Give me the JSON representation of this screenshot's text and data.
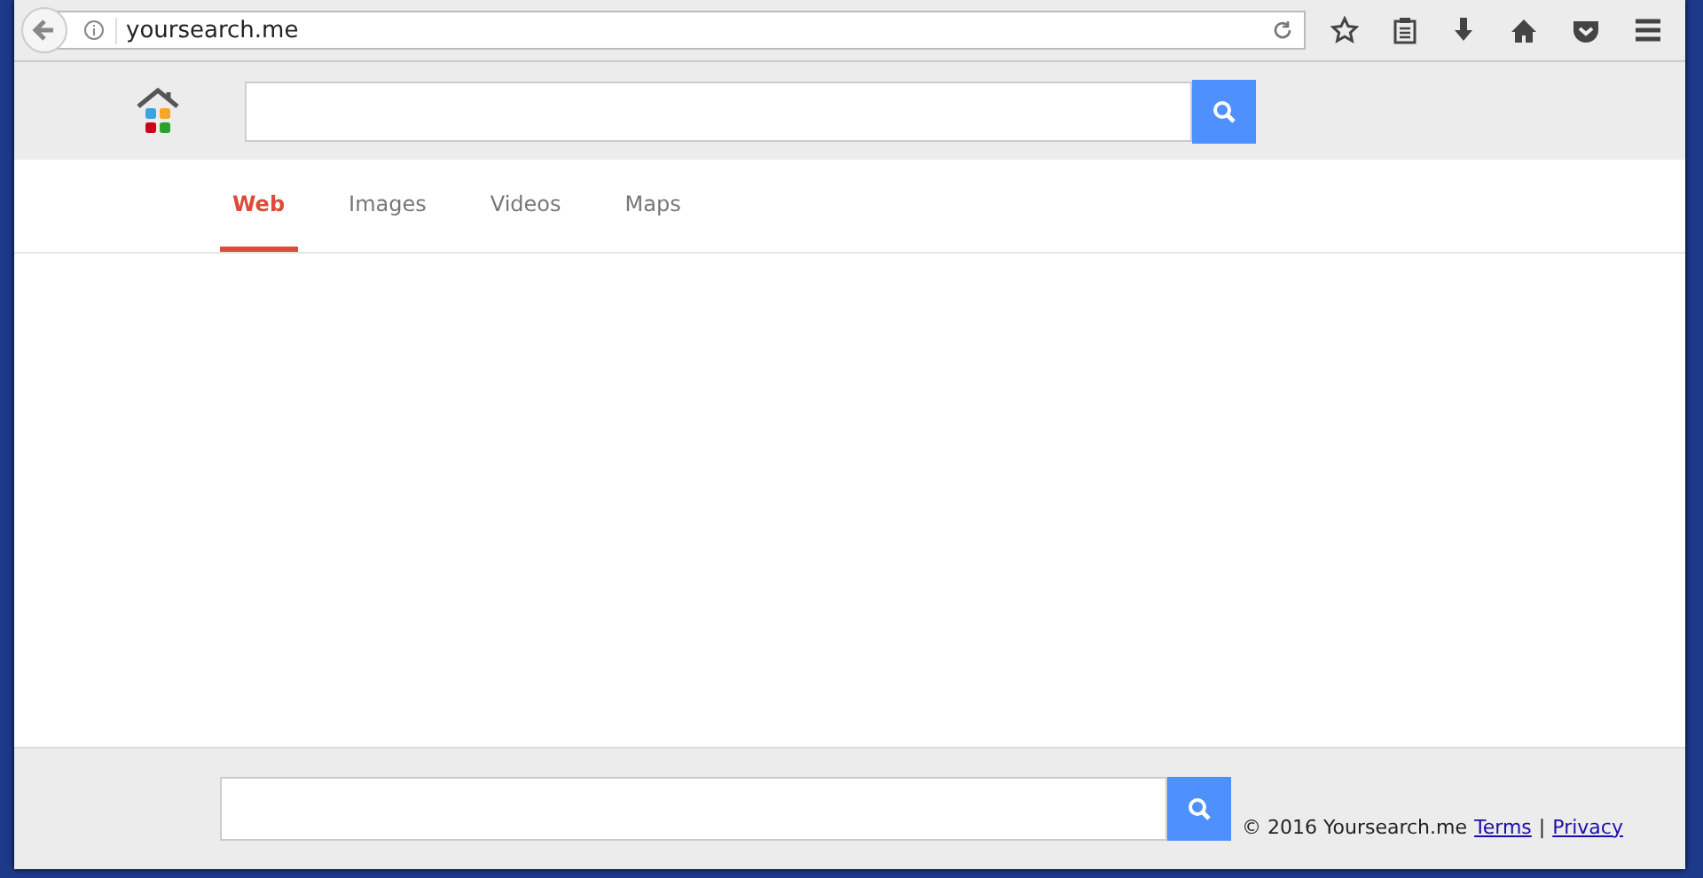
{
  "browser": {
    "url": "yoursearch.me"
  },
  "tabs": [
    {
      "label": "Web",
      "selected": true
    },
    {
      "label": "Images",
      "selected": false
    },
    {
      "label": "Videos",
      "selected": false
    },
    {
      "label": "Maps",
      "selected": false
    }
  ],
  "footer": {
    "copyright": "© 2016 Yoursearch.me",
    "links": [
      "Terms",
      "Privacy"
    ],
    "separator": "|"
  }
}
